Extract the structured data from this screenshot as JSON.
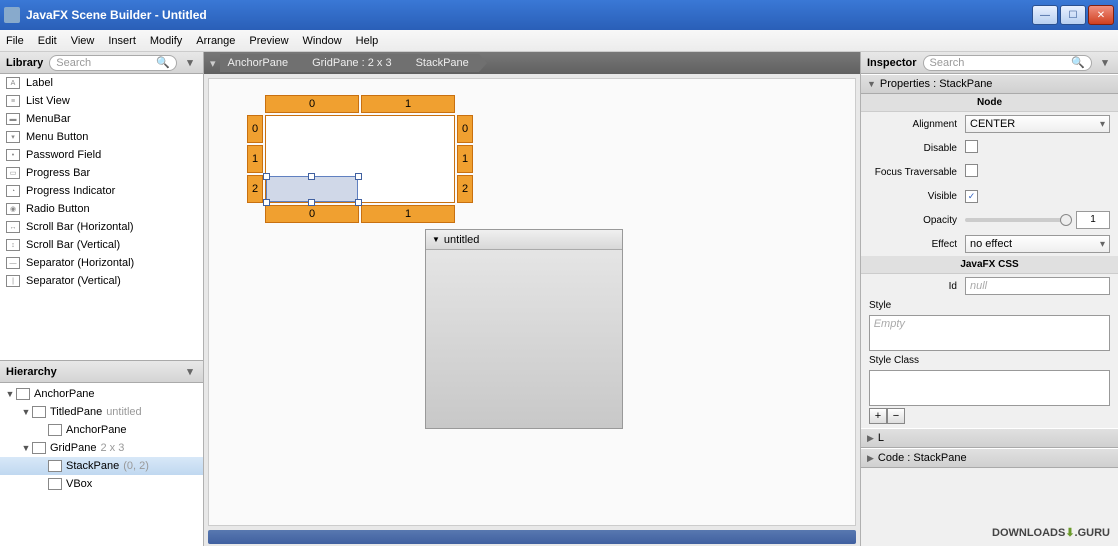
{
  "window": {
    "title": "JavaFX Scene Builder - Untitled"
  },
  "menubar": [
    "File",
    "Edit",
    "View",
    "Insert",
    "Modify",
    "Arrange",
    "Preview",
    "Window",
    "Help"
  ],
  "library": {
    "title": "Library",
    "search_placeholder": "Search",
    "items": [
      "Label",
      "List View",
      "MenuBar",
      "Menu Button",
      "Password Field",
      "Progress Bar",
      "Progress Indicator",
      "Radio Button",
      "Scroll Bar (Horizontal)",
      "Scroll Bar (Vertical)",
      "Separator (Horizontal)",
      "Separator (Vertical)"
    ]
  },
  "hierarchy": {
    "title": "Hierarchy",
    "rows": [
      {
        "indent": 0,
        "arrow": "▼",
        "label": "AnchorPane",
        "dim": ""
      },
      {
        "indent": 1,
        "arrow": "▼",
        "label": "TitledPane",
        "dim": "untitled"
      },
      {
        "indent": 2,
        "arrow": "",
        "label": "AnchorPane",
        "dim": ""
      },
      {
        "indent": 1,
        "arrow": "▼",
        "label": "GridPane",
        "dim": "2 x 3"
      },
      {
        "indent": 2,
        "arrow": "",
        "label": "StackPane",
        "dim": "(0, 2)",
        "sel": true
      },
      {
        "indent": 2,
        "arrow": "",
        "label": "VBox",
        "dim": ""
      }
    ]
  },
  "breadcrumb": [
    "AnchorPane",
    "GridPane : 2 x 3",
    "StackPane"
  ],
  "grid": {
    "cols": [
      "0",
      "1"
    ],
    "rows": [
      "0",
      "1",
      "2"
    ],
    "bottom_cols": [
      "0",
      "1"
    ]
  },
  "titled_pane": {
    "title": "untitled"
  },
  "inspector": {
    "title": "Inspector",
    "search_placeholder": "Search",
    "properties_title": "Properties : StackPane",
    "node_title": "Node",
    "alignment": {
      "label": "Alignment",
      "value": "CENTER"
    },
    "disable": {
      "label": "Disable",
      "checked": false
    },
    "focus": {
      "label": "Focus Traversable",
      "checked": false
    },
    "visible": {
      "label": "Visible",
      "checked": true
    },
    "opacity": {
      "label": "Opacity",
      "value": "1"
    },
    "effect": {
      "label": "Effect",
      "value": "no effect"
    },
    "css_title": "JavaFX CSS",
    "id": {
      "label": "Id",
      "placeholder": "null"
    },
    "style": {
      "label": "Style",
      "placeholder": "Empty"
    },
    "style_class": {
      "label": "Style Class"
    },
    "layout_title": "L",
    "code_title": "Code : StackPane"
  },
  "watermark": {
    "a": "DOWNLOADS",
    "b": ".GURU"
  }
}
